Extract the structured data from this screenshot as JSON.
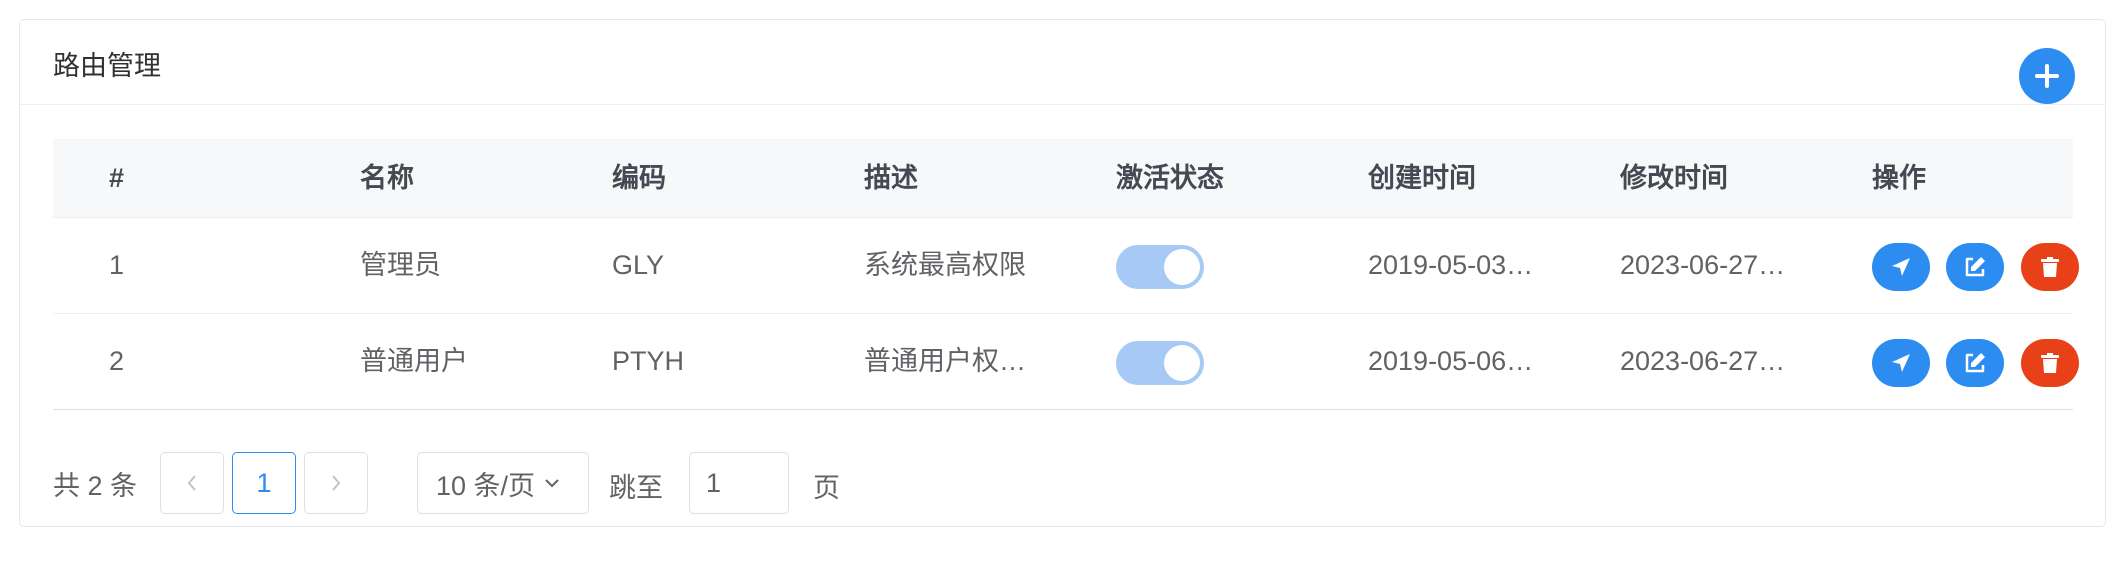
{
  "header": {
    "title": "路由管理"
  },
  "table": {
    "columns": [
      "#",
      "名称",
      "编码",
      "描述",
      "激活状态",
      "创建时间",
      "修改时间",
      "操作"
    ],
    "rows": [
      {
        "index": "1",
        "name": "管理员",
        "code": "GLY",
        "desc": "系统最高权限",
        "active": true,
        "created": "2019-05-03…",
        "modified": "2023-06-27…"
      },
      {
        "index": "2",
        "name": "普通用户",
        "code": "PTYH",
        "desc": "普通用户权…",
        "active": true,
        "created": "2019-05-06…",
        "modified": "2023-06-27…"
      }
    ]
  },
  "pagination": {
    "total": "共 2 条",
    "current_page": "1",
    "page_size": "10 条/页",
    "jump_label": "跳至",
    "jump_value": "1",
    "page_suffix": "页"
  },
  "colors": {
    "primary": "#2d8cf0",
    "danger": "#e8411a",
    "switch_on": "#a6c9f5"
  },
  "icons": {
    "add": "plus-icon",
    "navigate": "location-arrow-icon",
    "edit": "edit-icon",
    "delete": "trash-icon",
    "prev": "chevron-left-icon",
    "next": "chevron-right-icon",
    "dropdown": "chevron-down-icon"
  }
}
